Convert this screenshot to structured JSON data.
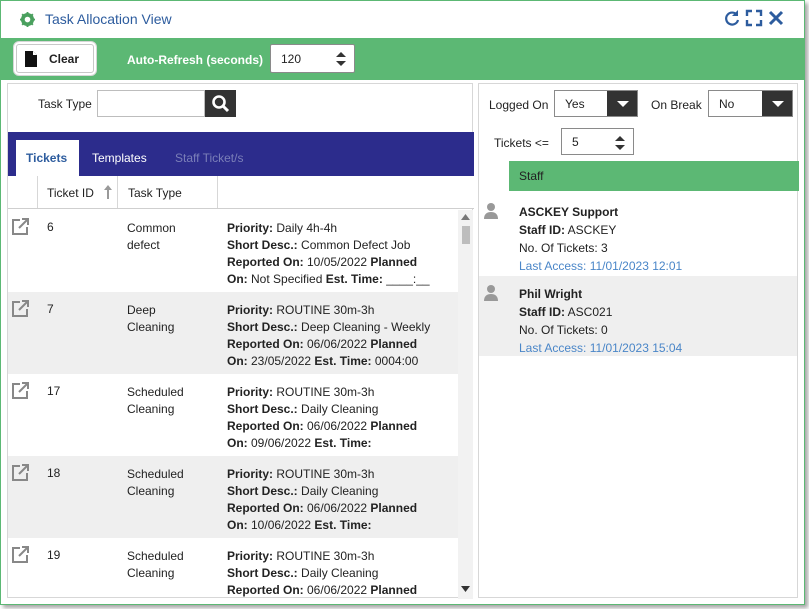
{
  "window": {
    "title": "Task Allocation View"
  },
  "toolbar": {
    "clear_label": "Clear",
    "auto_refresh_label": "Auto-Refresh (seconds)",
    "auto_refresh_value": "120"
  },
  "left": {
    "task_type_label": "Task Type",
    "task_type_value": "",
    "tabs": [
      {
        "label": "Tickets",
        "state": "active"
      },
      {
        "label": "Templates",
        "state": "normal"
      },
      {
        "label": "Staff Ticket/s",
        "state": "disabled"
      }
    ],
    "columns": {
      "ticket_id": "Ticket ID",
      "task_type": "Task Type"
    },
    "rows": [
      {
        "id": "6",
        "type1": "Common",
        "type2": "defect",
        "priority_lbl": "Priority:",
        "priority": " Daily 4h-4h",
        "short_lbl": "Short Desc.:",
        "short": " Common Defect Job",
        "reported_lbl": "Reported On:",
        "reported": " 10/05/2022 ",
        "planned_lbl": "Planned",
        "on_lbl": "On:",
        "on": " Not Specified ",
        "est_lbl": "Est. Time:",
        "est": " ____:__"
      },
      {
        "id": "7",
        "type1": "Deep",
        "type2": "Cleaning",
        "priority_lbl": "Priority:",
        "priority": " ROUTINE 30m-3h",
        "short_lbl": "Short Desc.:",
        "short": " Deep Cleaning - Weekly",
        "reported_lbl": "Reported On:",
        "reported": " 06/06/2022 ",
        "planned_lbl": "Planned",
        "on_lbl": "On:",
        "on": " 23/05/2022 ",
        "est_lbl": "Est. Time:",
        "est": " 0004:00"
      },
      {
        "id": "17",
        "type1": "Scheduled",
        "type2": "Cleaning",
        "priority_lbl": "Priority:",
        "priority": " ROUTINE 30m-3h",
        "short_lbl": "Short Desc.:",
        "short": " Daily Cleaning",
        "reported_lbl": "Reported On:",
        "reported": " 06/06/2022 ",
        "planned_lbl": "Planned",
        "on_lbl": "On:",
        "on": " 09/06/2022 ",
        "est_lbl": "Est. Time:",
        "est": ""
      },
      {
        "id": "18",
        "type1": "Scheduled",
        "type2": "Cleaning",
        "priority_lbl": "Priority:",
        "priority": " ROUTINE 30m-3h",
        "short_lbl": "Short Desc.:",
        "short": " Daily Cleaning",
        "reported_lbl": "Reported On:",
        "reported": " 06/06/2022 ",
        "planned_lbl": "Planned",
        "on_lbl": "On:",
        "on": " 10/06/2022 ",
        "est_lbl": "Est. Time:",
        "est": ""
      },
      {
        "id": "19",
        "type1": "Scheduled",
        "type2": "Cleaning",
        "priority_lbl": "Priority:",
        "priority": " ROUTINE 30m-3h",
        "short_lbl": "Short Desc.:",
        "short": " Daily Cleaning",
        "reported_lbl": "Reported On:",
        "reported": " 06/06/2022 ",
        "planned_lbl": "Planned",
        "on_lbl": "",
        "on": "",
        "est_lbl": "",
        "est": ""
      }
    ]
  },
  "right": {
    "logged_on_label": "Logged On",
    "logged_on_value": "Yes",
    "on_break_label": "On Break",
    "on_break_value": "No",
    "tickets_label": "Tickets <=",
    "tickets_value": "5",
    "staff_header": "Staff",
    "staff": [
      {
        "name": "ASCKEY Support",
        "id_lbl": "Staff ID:",
        "id": " ASCKEY",
        "count": "No. Of Tickets: 3",
        "last_access": "Last Access: 11/01/2023 12:01"
      },
      {
        "name": "Phil Wright",
        "id_lbl": "Staff ID:",
        "id": " ASC021",
        "count": "No. Of Tickets: 0",
        "last_access": "Last Access: 11/01/2023 15:04"
      }
    ]
  },
  "colors": {
    "green": "#5cb874",
    "navy": "#2c2c8c",
    "title_blue": "#2d5c9e",
    "link_blue": "#4a86c8"
  }
}
